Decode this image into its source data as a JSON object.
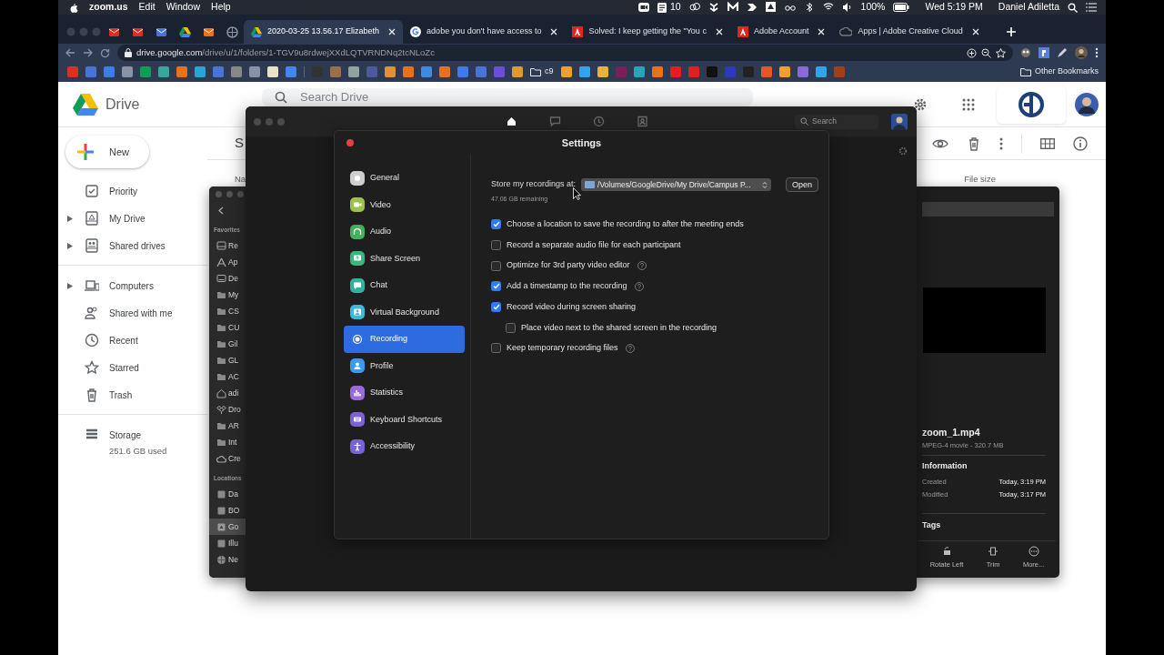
{
  "menu_bar": {
    "app": "zoom.us",
    "items": [
      "Edit",
      "Window",
      "Help"
    ],
    "notification_count": "10",
    "battery": "100%",
    "clock": "Wed 5:19 PM",
    "user": "Daniel Adiletta"
  },
  "browser": {
    "tabs": [
      {
        "label": "2020-03-25 13.56.17 Elizabeth",
        "kind": "drive",
        "selected": true
      },
      {
        "label": "adobe you don't have access to",
        "kind": "google",
        "selected": false
      },
      {
        "label": "Solved: I keep getting the \"You c",
        "kind": "adobe",
        "selected": false
      },
      {
        "label": "Adobe Account",
        "kind": "adobe",
        "selected": false
      },
      {
        "label": "Apps | Adobe Creative Cloud",
        "kind": "cc",
        "selected": false
      }
    ],
    "address_host": "drive.google.com",
    "address_path": "/drive/u/1/folders/1-TGV9u8rdwejXXdLQTVRNDNq2tcNLoZc",
    "bookmark_folder": "c9",
    "other_bookmarks": "Other Bookmarks"
  },
  "drive": {
    "brand": "Drive",
    "search_placeholder": "Search Drive",
    "new_button": "New",
    "nav_groups": [
      [
        {
          "label": "Priority",
          "kind": "priority"
        },
        {
          "label": "My Drive",
          "kind": "mydrive",
          "expanded": false
        },
        {
          "label": "Shared drives",
          "kind": "shareddrives",
          "expanded": false
        }
      ],
      [
        {
          "label": "Computers",
          "kind": "computers",
          "expanded": false
        },
        {
          "label": "Shared with me",
          "kind": "sharedwithme"
        },
        {
          "label": "Recent",
          "kind": "recent"
        },
        {
          "label": "Starred",
          "kind": "starred"
        },
        {
          "label": "Trash",
          "kind": "trash"
        }
      ]
    ],
    "storage_label": "Storage",
    "storage_used": "251.6 GB used",
    "folder_title": "S",
    "columns": [
      "Na",
      "File size"
    ]
  },
  "finder": {
    "favorites_heading": "Favorites",
    "favorites": [
      {
        "label": "Re",
        "kind": "recents",
        "selected": false
      },
      {
        "label": "Ap",
        "kind": "apps",
        "selected": false
      },
      {
        "label": "De",
        "kind": "desktop",
        "selected": false
      },
      {
        "label": "My",
        "kind": "folder",
        "selected": false
      },
      {
        "label": "CS",
        "kind": "folder",
        "selected": false
      },
      {
        "label": "CU",
        "kind": "folder",
        "selected": false
      },
      {
        "label": "Gil",
        "kind": "folder",
        "selected": false
      },
      {
        "label": "GL",
        "kind": "folder",
        "selected": false
      },
      {
        "label": "AC",
        "kind": "folder",
        "selected": false
      },
      {
        "label": "adi",
        "kind": "home",
        "selected": false
      },
      {
        "label": "Dro",
        "kind": "dropbox",
        "selected": false
      },
      {
        "label": "AR",
        "kind": "folder",
        "selected": false
      },
      {
        "label": "Int",
        "kind": "folder",
        "selected": false
      },
      {
        "label": "Cre",
        "kind": "cloud",
        "selected": false
      }
    ],
    "locations_heading": "Locations",
    "locations": [
      {
        "label": "Da",
        "kind": "disk",
        "selected": false
      },
      {
        "label": "BO",
        "kind": "disk",
        "selected": false
      },
      {
        "label": "Go",
        "kind": "drive",
        "selected": true
      },
      {
        "label": "Illu",
        "kind": "disk",
        "selected": false
      },
      {
        "label": "Ne",
        "kind": "network",
        "selected": false
      }
    ],
    "preview": {
      "file_name": "zoom_1.mp4",
      "file_info": "MPEG-4 movie - 320.7 MB",
      "info_heading": "Information",
      "rows": [
        {
          "label": "Created",
          "value": "Today, 3:19 PM"
        },
        {
          "label": "Modified",
          "value": "Today, 3:17 PM"
        }
      ],
      "tags_heading": "Tags",
      "actions": [
        {
          "label": "Rotate Left",
          "kind": "rotate"
        },
        {
          "label": "Trim",
          "kind": "trim"
        },
        {
          "label": "More...",
          "kind": "more"
        }
      ]
    }
  },
  "zoom": {
    "tabs": [
      {
        "kind": "home",
        "selected": true
      },
      {
        "kind": "chat",
        "selected": false
      },
      {
        "kind": "meetings",
        "selected": false
      },
      {
        "kind": "contacts",
        "selected": false
      }
    ],
    "search_placeholder": "Search"
  },
  "settings": {
    "title": "Settings",
    "nav": [
      {
        "label": "General",
        "kind": "general",
        "selected": false
      },
      {
        "label": "Video",
        "kind": "video",
        "selected": false
      },
      {
        "label": "Audio",
        "kind": "audio",
        "selected": false
      },
      {
        "label": "Share Screen",
        "kind": "share",
        "selected": false
      },
      {
        "label": "Chat",
        "kind": "chat",
        "selected": false
      },
      {
        "label": "Virtual Background",
        "kind": "background",
        "selected": false
      },
      {
        "label": "Recording",
        "kind": "recording",
        "selected": true
      },
      {
        "label": "Profile",
        "kind": "profile",
        "selected": false
      },
      {
        "label": "Statistics",
        "kind": "statistics",
        "selected": false
      },
      {
        "label": "Keyboard Shortcuts",
        "kind": "keyboard",
        "selected": false
      },
      {
        "label": "Accessibility",
        "kind": "accessibility",
        "selected": false
      }
    ],
    "store_label": "Store my recordings at:",
    "path": "/Volumes/GoogleDrive/My Drive/Campus P...",
    "open_button": "Open",
    "remaining": "47.06 GB remaining",
    "options": [
      {
        "label": "Choose a location to save the recording to after the meeting ends",
        "checked": true,
        "help": false
      },
      {
        "label": "Record a separate audio file for each participant",
        "checked": false,
        "help": false
      },
      {
        "label": "Optimize for 3rd party video editor",
        "checked": false,
        "help": true
      },
      {
        "label": "Add a timestamp to the recording",
        "checked": true,
        "help": true
      },
      {
        "label": "Record video during screen sharing",
        "checked": true,
        "help": false,
        "children": [
          {
            "label": "Place video next to the shared screen in the recording",
            "checked": false,
            "help": false
          }
        ]
      },
      {
        "label": "Keep temporary recording files",
        "checked": false,
        "help": true
      }
    ]
  }
}
